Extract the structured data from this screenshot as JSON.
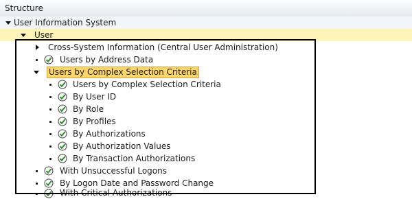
{
  "header": {
    "title": "Structure"
  },
  "tree": {
    "root": "User Information System",
    "user": "User",
    "cross_system": "Cross-System Information (Central User Administration)",
    "address": "Users by Address Data",
    "complex": "Users by Complex Selection Criteria",
    "children": [
      "Users by Complex Selection Criteria",
      "By User ID",
      "By Role",
      "By Profiles",
      "By Authorizations",
      "By Authorization Values",
      "By Transaction Authorizations"
    ],
    "unsuccessful": "With Unsuccessful Logons",
    "logon_date": "By Logon Date and Password Change",
    "critical": "With Critical Authorizations"
  },
  "icons": {
    "execute": "clock-check-icon",
    "expand": "triangle-down-icon",
    "collapse": "triangle-right-icon"
  },
  "colors": {
    "selected": "#ffd66b",
    "check": "#2d8a2d"
  }
}
